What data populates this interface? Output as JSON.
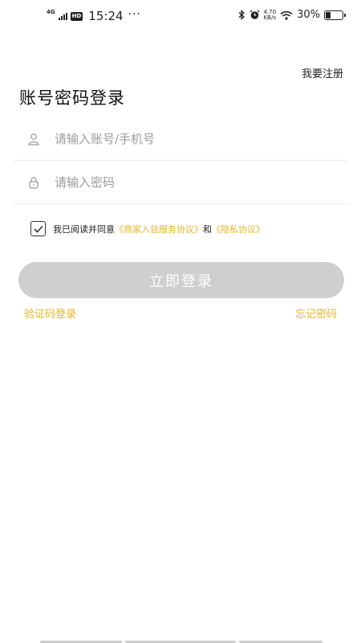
{
  "status_bar": {
    "network": "4G",
    "hd": "HD",
    "time": "15:24",
    "more": "···",
    "speed_value": "4.70",
    "speed_unit": "KB/s",
    "battery_percent": "30%",
    "battery_level": 0.3,
    "icons": [
      "signal-icon",
      "bluetooth-icon",
      "alarm-icon",
      "wifi-icon",
      "battery-icon"
    ]
  },
  "header": {
    "register_link": "我要注册",
    "title": "账号密码登录"
  },
  "form": {
    "account_placeholder": "请输入账号/手机号",
    "account_value": "",
    "password_placeholder": "请输入密码",
    "password_value": ""
  },
  "agreement": {
    "checked": true,
    "prefix": "我已阅读并同意",
    "merchant_agreement": "《商家入驻服务协议》",
    "conjunction": "和",
    "privacy_agreement": "《隐私协议》"
  },
  "actions": {
    "login_button": "立即登录",
    "sms_login": "验证码登录",
    "forgot_password": "忘记密码"
  },
  "colors": {
    "accent": "#e8b424",
    "button_disabled": "#cfcfcf"
  }
}
